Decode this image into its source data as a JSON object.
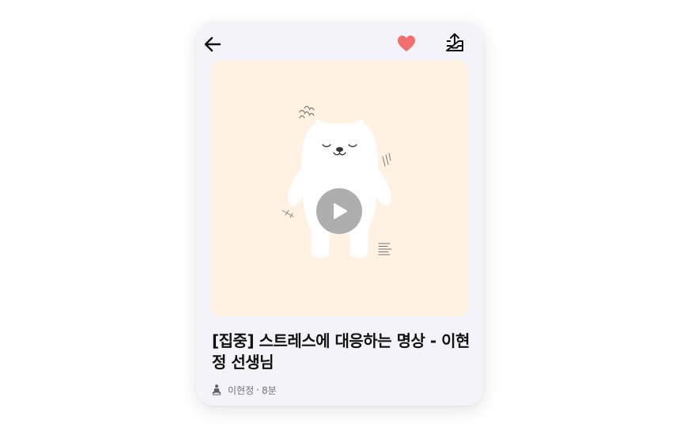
{
  "header": {
    "back_icon": "arrow-left-icon",
    "favorite_icon": "heart-icon",
    "favorite_active": true,
    "share_icon": "share-tray-icon"
  },
  "media": {
    "background_color": "#fff2e3",
    "illustration_icon": "meditating-bear-illustration",
    "play_icon": "play-icon"
  },
  "content": {
    "title": "[집중] 스트레스에 대응하는 명상 - 이현정 선생님",
    "teacher_icon": "meditation-person-icon",
    "teacher": "이현정",
    "separator": "·",
    "duration": "8분"
  },
  "colors": {
    "heart": "#f36f6f",
    "card_background": "#f4f3f9",
    "title_text": "#111111",
    "meta_text": "#6f6f76"
  }
}
